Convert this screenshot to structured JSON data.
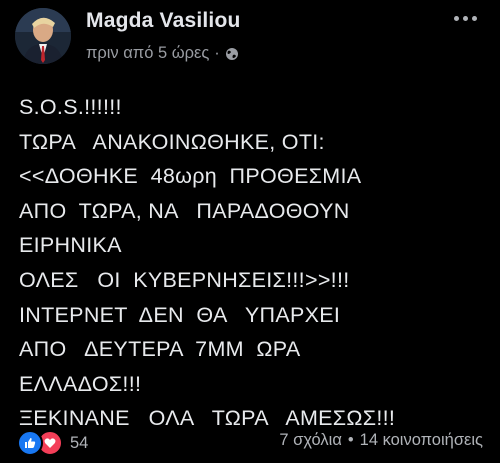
{
  "post": {
    "author": "Magda Vasiliou",
    "time": "πριν από 5 ώρες",
    "separator": "·",
    "audience_icon": "globe-icon",
    "lines": [
      "S.O.S.!!!!!!",
      "ΤΩΡΑ   ΑΝΑΚΟΙΝΩΘΗΚΕ, ΟΤΙ:",
      "<<ΔΟΘΗΚΕ  48ωρη  ΠΡΟΘΕΣΜΙΑ",
      "ΑΠΟ  ΤΩΡΑ, ΝΑ   ΠΑΡΑΔΟΘΟΥΝ",
      "ΕΙΡΗΝΙΚΑ",
      "ΟΛΕΣ   ΟΙ  ΚΥΒΕΡΝΗΣΕΙΣ!!!>>!!!",
      "ΙΝΤΕΡΝΕΤ  ΔΕΝ  ΘΑ   ΥΠΑΡΧΕΙ",
      "ΑΠΟ   ΔΕΥΤΕΡΑ  7ΜΜ  ΩΡΑ",
      "ΕΛΛΑΔΟΣ!!!",
      "ΞΕΚΙΝΑΝΕ   ΟΛΑ   ΤΩΡΑ   ΑΜΕΣΩΣ!!!"
    ]
  },
  "footer": {
    "reaction_icons": [
      "like-icon",
      "love-icon"
    ],
    "reaction_count": "54",
    "comments": "7 σχόλια",
    "dot": "•",
    "shares": "14 κοινοποιήσεις"
  },
  "colors": {
    "background": "#000000",
    "text": "#e4e6eb",
    "muted": "#9a9da3",
    "like": "#1877f2",
    "love": "#f33e58"
  }
}
